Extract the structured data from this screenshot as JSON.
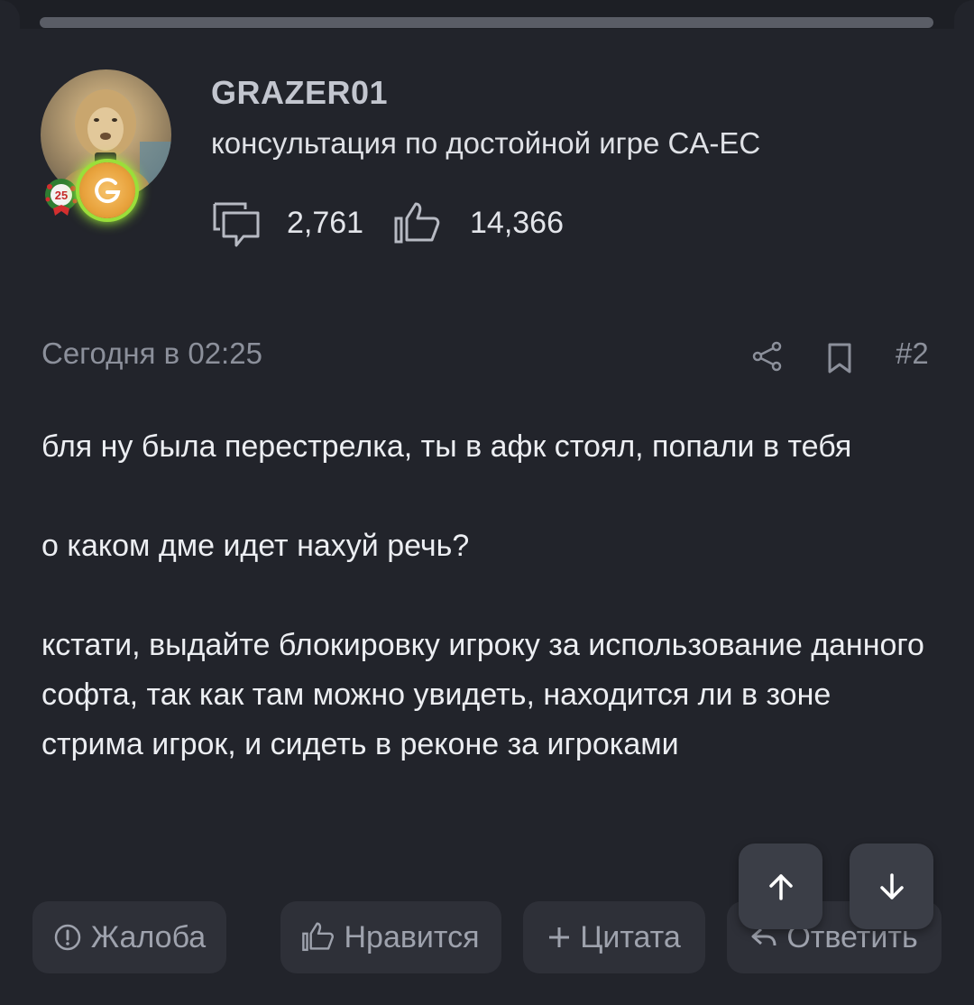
{
  "author": {
    "name": "GRAZER01",
    "title": "консультация по достойной игре CA-EC",
    "award_badge": "25",
    "messages_count": "2,761",
    "likes_count": "14,366",
    "icons": {
      "messages": "comment-icon",
      "likes": "thumbs-up-icon"
    }
  },
  "post": {
    "date": "Сегодня в 02:25",
    "number": "#2",
    "paragraphs": [
      "бля ну была перестрелка, ты в афк стоял, попали в тебя",
      "о каком дме идет нахуй речь?",
      "кстати, выдайте блокировку игроку за использование данного софта, так как там можно увидеть, находится ли в зоне стрима игрок, и сидеть в реконе за игроками"
    ]
  },
  "actions": {
    "report_label": "Жалоба",
    "like_label": "Нравится",
    "quote_label": "Цитата",
    "reply_label": "Ответить"
  },
  "colors": {
    "background": "#22242b",
    "button_bg": "#2e3038",
    "muted_text": "#8c909b",
    "group_badge_glow": "#a8ff3a"
  }
}
